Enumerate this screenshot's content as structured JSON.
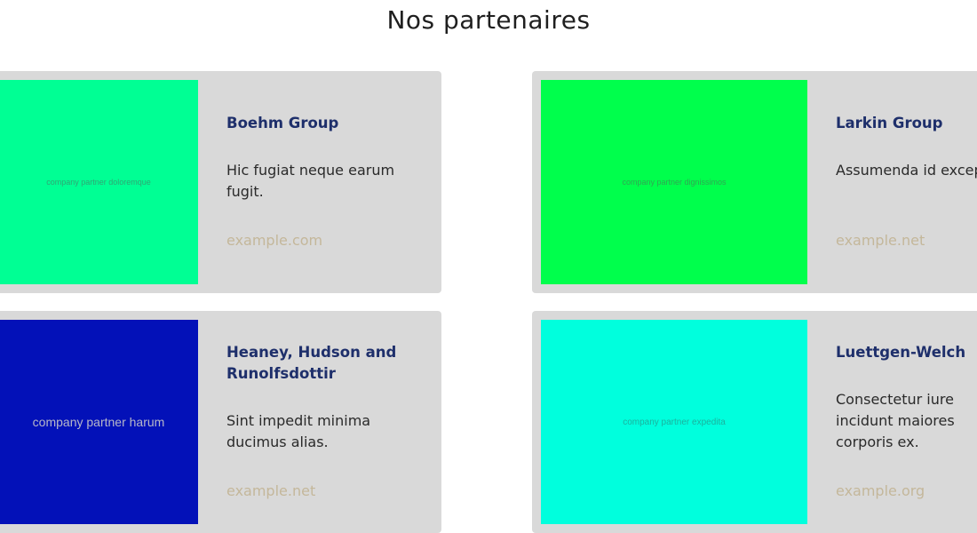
{
  "section": {
    "title": "Nos partenaires"
  },
  "partners": [
    {
      "name": "Boehm Group",
      "description": "Hic fugiat neque earum fugit.",
      "link": "example.com",
      "logo_alt": "company partner doloremque",
      "logo_color": "#00ff94"
    },
    {
      "name": "Larkin Group",
      "description": "Assumenda id excep ea qui.",
      "link": "example.net",
      "logo_alt": "company partner dignissimos",
      "logo_color": "#00ff4c"
    },
    {
      "name": "Heaney, Hudson and Runolfsdottir",
      "description": "Sint impedit minima ducimus alias.",
      "link": "example.net",
      "logo_alt": "company partner harum",
      "logo_color": "#0311b8"
    },
    {
      "name": "Luettgen-Welch",
      "description": "Consectetur iure incidunt maiores corporis ex.",
      "link": "example.org",
      "logo_alt": "company partner expedita",
      "logo_color": "#00ffdd"
    }
  ],
  "colors": {
    "card_background": "#d9d9d9",
    "name_color": "#1e2f6b",
    "link_color": "#c4b79a"
  }
}
